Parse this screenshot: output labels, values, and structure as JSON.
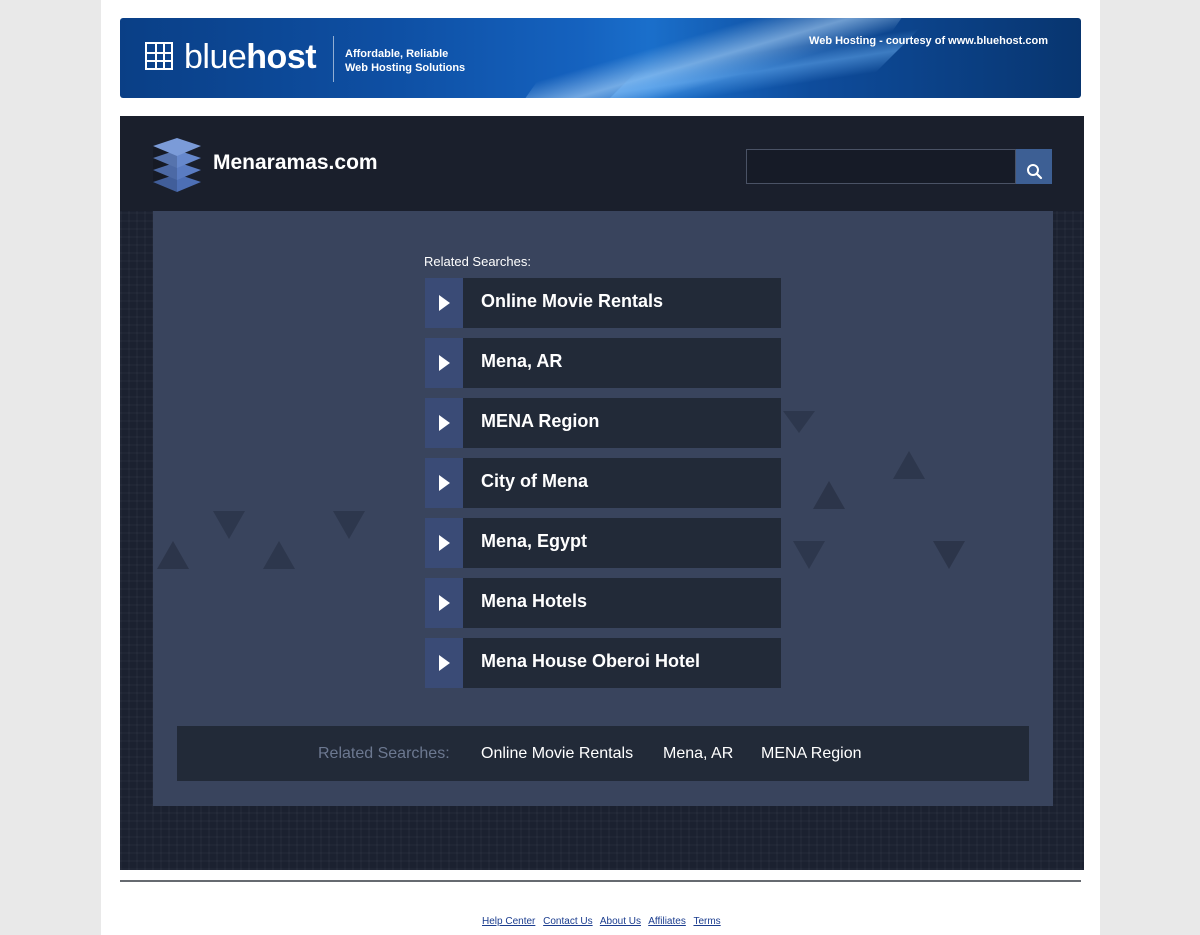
{
  "banner": {
    "brand_light": "blue",
    "brand_bold": "host",
    "tagline_line1": "Affordable, Reliable",
    "tagline_line2": "Web Hosting Solutions",
    "courtesy": "Web Hosting - courtesy of www.bluehost.com"
  },
  "site": {
    "title": "Menaramas.com",
    "search_value": "",
    "related_label": "Related Searches:",
    "results": [
      "Online Movie Rentals",
      "Mena, AR",
      "MENA Region",
      "City of Mena",
      "Mena, Egypt",
      "Mena Hotels",
      "Mena House Oberoi Hotel"
    ],
    "bottom_label": "Related Searches:",
    "bottom_links": [
      "Online Movie Rentals",
      "Mena, AR",
      "MENA Region"
    ]
  },
  "footer": {
    "links": [
      "Help Center",
      "Contact Us",
      "About Us",
      "Affiliates",
      "Terms"
    ]
  },
  "colors": {
    "banner_blue": "#0e4fa3",
    "site_bg": "#1b2130",
    "panel_bg": "#39445d",
    "result_bg": "#222a38",
    "arrow_bg": "#3a4b76",
    "search_btn": "#3d5f94",
    "footer_link": "#1a3c8e"
  },
  "icons": {
    "banner_logo": "grid-logo-icon",
    "site_logo": "layer-stack-icon",
    "search": "search-icon",
    "result_arrow": "play-arrow-icon"
  }
}
